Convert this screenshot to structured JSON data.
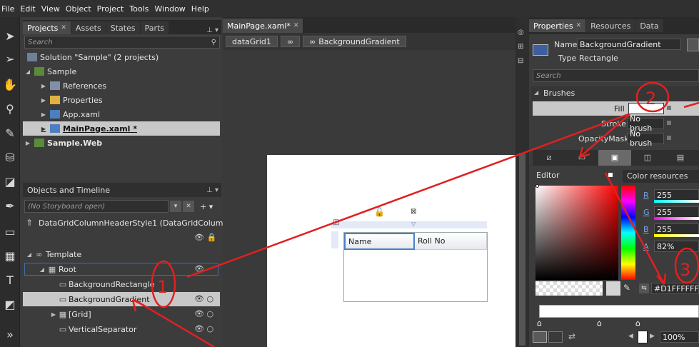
{
  "menu": [
    "File",
    "Edit",
    "View",
    "Object",
    "Project",
    "Tools",
    "Window",
    "Help"
  ],
  "projects_panel": {
    "tabs": [
      "Projects",
      "Assets",
      "States",
      "Parts"
    ],
    "search_placeholder": "Search",
    "solution": "Solution \"Sample\" (2 projects)",
    "items": [
      "Sample",
      "References",
      "Properties",
      "App.xaml",
      "MainPage.xaml *",
      "Sample.Web"
    ]
  },
  "objects_panel": {
    "title": "Objects and Timeline",
    "storyboard": "(No Storyboard open)",
    "style_root": "DataGridColumnHeaderStyle1 (DataGridColum...",
    "items": [
      "Template",
      "Root",
      "BackgroundRectangle",
      "BackgroundGradient",
      "[Grid]",
      "VerticalSeparator"
    ]
  },
  "document": {
    "tab": "MainPage.xaml*",
    "breadcrumb": [
      "dataGrid1",
      "BackgroundGradient"
    ],
    "grid_headers": [
      "Name",
      "Roll No"
    ]
  },
  "properties_panel": {
    "tabs": [
      "Properties",
      "Resources",
      "Data"
    ],
    "name_label": "Name",
    "name_value": "BackgroundGradient",
    "type_label": "Type",
    "type_value": "Rectangle",
    "search_placeholder": "Search",
    "brushes_title": "Brushes",
    "fill_label": "Fill",
    "stroke_label": "Stroke",
    "stroke_value": "No brush",
    "opacity_label": "OpacityMask",
    "opacity_value": "No brush",
    "editor_label": "Editor",
    "color_resources": "Color resources",
    "channels": [
      {
        "label": "R",
        "value": "255"
      },
      {
        "label": "G",
        "value": "255"
      },
      {
        "label": "B",
        "value": "255"
      },
      {
        "label": "A",
        "value": "82%"
      }
    ],
    "hex_value": "#D1FFFFFF",
    "zoom": "100%"
  },
  "annotations": [
    "1",
    "2",
    "3"
  ],
  "colors": {
    "annotation": "#e02020",
    "accent": "#3d6fb0",
    "selected_row": "#c8c8c8"
  }
}
